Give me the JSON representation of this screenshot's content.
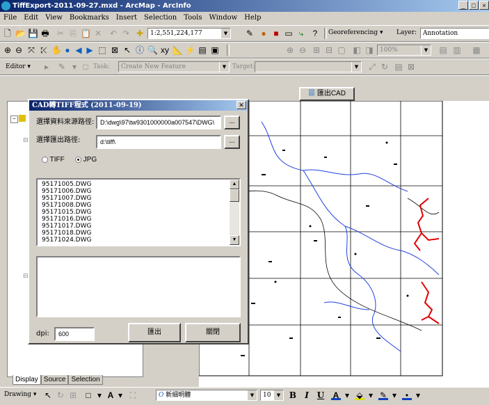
{
  "window": {
    "title": "TiffExport-2011-09-27.mxd - ArcMap - ArcInfo"
  },
  "menu": [
    "File",
    "Edit",
    "View",
    "Bookmarks",
    "Insert",
    "Selection",
    "Tools",
    "Window",
    "Help"
  ],
  "standard_toolbar": {
    "scale": "1:2,551,224,177",
    "georef_label": "Georeferencing ▾",
    "layer_label": "Layer:",
    "layer_value": "Annotation"
  },
  "editor_toolbar": {
    "editor_label": "Editor ▾",
    "task_label": "Task:",
    "task_value": "Create New Feature",
    "target_label": "Target:",
    "target_value": ""
  },
  "zoom_combo": "100%",
  "cad_button": "匯出CAD",
  "dialog": {
    "title": "CAD轉TIFF程式 (2011-09-19)",
    "source_label": "選擇資料來源路徑:",
    "source_value": "D:\\dwg\\97\\tw9301000000a007547\\DWG\\",
    "browse1": "...",
    "output_label": "選擇匯出路徑:",
    "output_value": "d:\\tiff\\",
    "browse2": "...",
    "radio_tiff": "TIFF",
    "radio_jpg": "JPG",
    "files": [
      "95171005.DWG",
      "95171006.DWG",
      "95171007.DWG",
      "95171008.DWG",
      "95171015.DWG",
      "95171016.DWG",
      "95171017.DWG",
      "95171018.DWG",
      "95171024.DWG"
    ],
    "dpi_label": "dpi:",
    "dpi_value": "600",
    "export_button": "匯出",
    "close_button": "關閉"
  },
  "toc_tabs": [
    "Display",
    "Source",
    "Selection"
  ],
  "drawing_toolbar": {
    "drawing_label": "Drawing ▾",
    "font_name": "新細明體",
    "font_size": "10",
    "bold": "B",
    "italic": "I",
    "underline": "U"
  }
}
